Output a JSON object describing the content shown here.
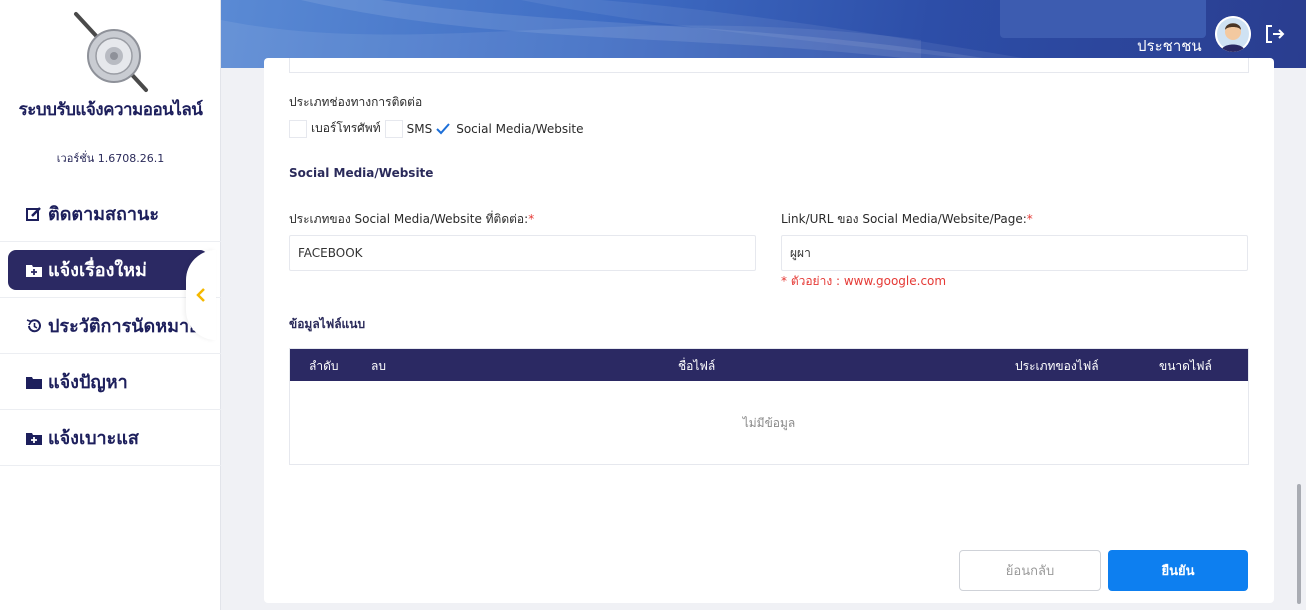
{
  "sidebar": {
    "app_title": "ระบบรับแจ้งความออนไลน์",
    "version": "เวอร์ชั่น 1.6708.26.1",
    "items": [
      {
        "label": "ติดตามสถานะ",
        "icon": "edit-icon"
      },
      {
        "label": "แจ้งเรื่องใหม่",
        "icon": "folder-plus-icon",
        "active": true
      },
      {
        "label": "ประวัติการนัดหมาย",
        "icon": "history-icon"
      },
      {
        "label": "แจ้งปัญหา",
        "icon": "folder-icon"
      },
      {
        "label": "แจ้งเบาะแส",
        "icon": "folder-plus-icon"
      }
    ]
  },
  "header": {
    "user_label": "ประชาชน"
  },
  "form": {
    "channel_label": "ประเภทช่องทางการติดต่อ",
    "channels": [
      {
        "label": "เบอร์โทรศัพท์",
        "checked": false
      },
      {
        "label": "SMS",
        "checked": false
      },
      {
        "label": "Social Media/Website",
        "checked": true
      }
    ],
    "social_section_title": "Social Media/Website",
    "social_type_label": "ประเภทของ Social Media/Website ที่ติดต่อ:",
    "social_type_value": "FACEBOOK",
    "link_label": "Link/URL ของ Social Media/Website/Page:",
    "link_value": "ผูผา",
    "link_hint": "* ตัวอย่าง : www.google.com",
    "required_mark": "*"
  },
  "attachments": {
    "title": "ข้อมูลไฟล์แนบ",
    "columns": [
      "ลำดับ",
      "ลบ",
      "ชื่อไฟล์",
      "ประเภทของไฟล์",
      "ขนาดไฟล์"
    ],
    "empty_text": "ไม่มีข้อมูล"
  },
  "buttons": {
    "back": "ย้อนกลับ",
    "confirm": "ยืนยัน"
  },
  "colors": {
    "navy": "#2b2963",
    "accent_blue": "#0d7ff0",
    "required_red": "#e53935",
    "collapse_arrow": "#f5b800"
  }
}
